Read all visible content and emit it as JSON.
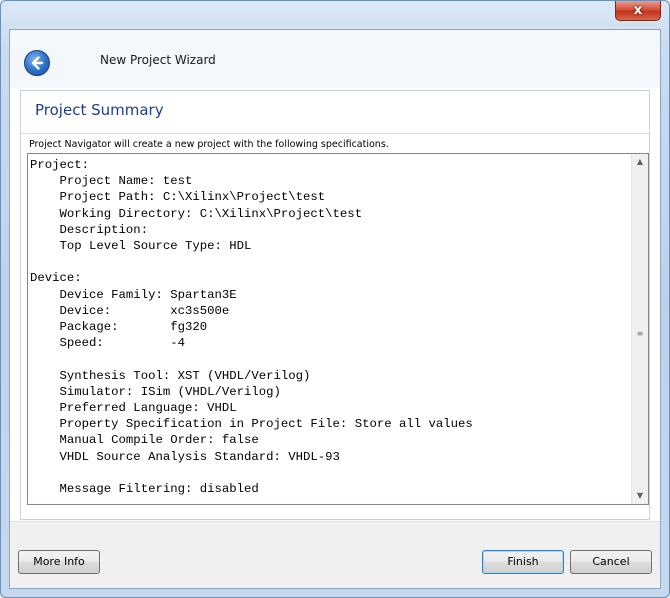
{
  "window": {
    "close_label": "x",
    "title": "New Project Wizard"
  },
  "page": {
    "title": "Project Summary",
    "instruction": "Project Navigator will create a new project with the following specifications."
  },
  "summary": {
    "text": "Project:\n    Project Name: test\n    Project Path: C:\\Xilinx\\Project\\test\n    Working Directory: C:\\Xilinx\\Project\\test\n    Description:\n    Top Level Source Type: HDL\n\nDevice:\n    Device Family: Spartan3E\n    Device:        xc3s500e\n    Package:       fg320\n    Speed:         -4\n\n    Synthesis Tool: XST (VHDL/Verilog)\n    Simulator: ISim (VHDL/Verilog)\n    Preferred Language: VHDL\n    Property Specification in Project File: Store all values\n    Manual Compile Order: false\n    VHDL Source Analysis Standard: VHDL-93\n\n    Message Filtering: disabled"
  },
  "buttons": {
    "more_info": "More Info",
    "finish": "Finish",
    "cancel": "Cancel"
  },
  "icons": {
    "back": "back-arrow-icon",
    "close": "close-icon",
    "scroll_up": "scroll-up-icon",
    "scroll_down": "scroll-down-icon"
  }
}
